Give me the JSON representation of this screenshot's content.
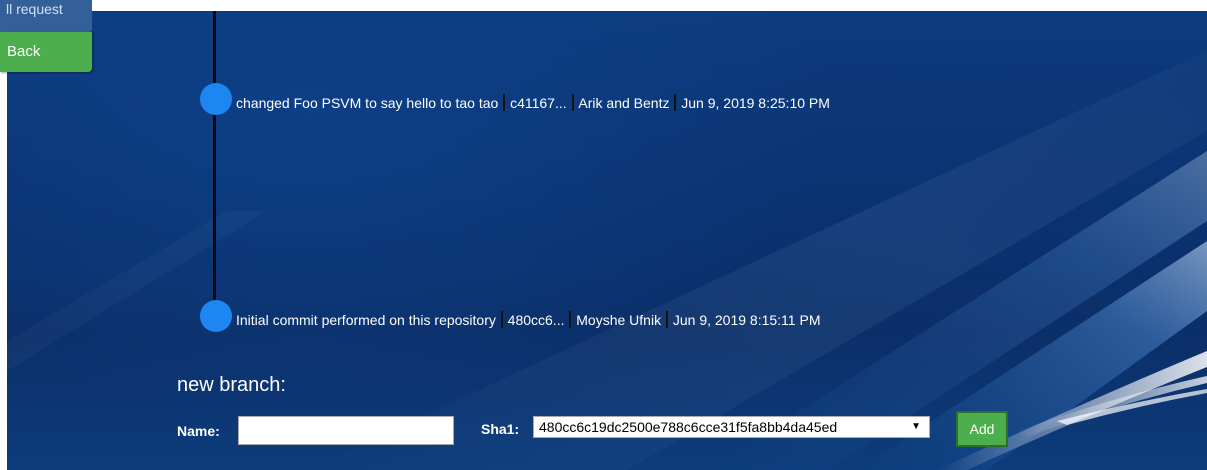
{
  "side_buttons": {
    "pull_request_label": "ll request",
    "back_label": "Back"
  },
  "commits": [
    {
      "message": "changed Foo PSVM to say hello to tao tao",
      "sha": "c41167...",
      "author": "Arik and Bentz",
      "date": "Jun 9, 2019 8:25:10 PM"
    },
    {
      "message": "Initial commit performed on this repository",
      "sha": "480cc6...",
      "author": "Moyshe Ufnik",
      "date": "Jun 9, 2019 8:15:11 PM"
    }
  ],
  "new_branch": {
    "title": "new branch:",
    "name_label": "Name:",
    "name_value": "",
    "sha_label": "Sha1:",
    "sha_selected": "480cc6c19dc2500e788c6cce31f5fa8bb4da45ed",
    "add_label": "Add"
  },
  "colors": {
    "background": "#0b3472",
    "timeline": "#05070c",
    "commit_dot": "#1e86f0",
    "button_green": "#4cae4c",
    "pull_request_blue": "#34609a",
    "text": "#ffffff"
  },
  "icons": {
    "select_caret": "dropdown-caret-icon"
  }
}
